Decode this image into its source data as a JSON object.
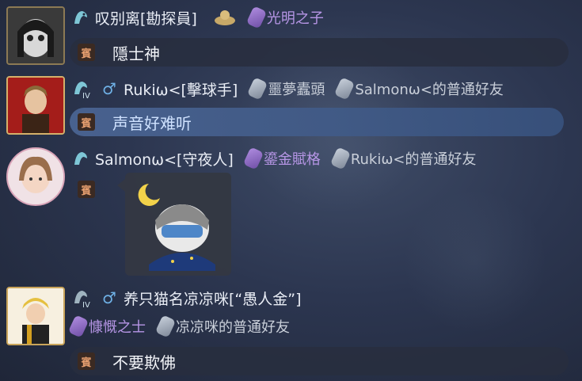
{
  "messages": [
    {
      "name": "叹别离[勘探員]",
      "tags": [
        {
          "label": "光明之子",
          "color": "purple"
        }
      ],
      "text": "隱士神"
    },
    {
      "name": "Rukiω<[擊球手]",
      "level_icon": "IV",
      "tags": [
        {
          "label": "噩夢蠹頭",
          "color": "grey"
        },
        {
          "label": "Salmonω<的普通好友",
          "color": "grey"
        }
      ],
      "text": "声音好难听"
    },
    {
      "name": "Salmonω<[守夜人]",
      "tags": [
        {
          "label": "鎏金賦格",
          "color": "purple"
        },
        {
          "label": "Rukiω<的普通好友",
          "color": "grey"
        }
      ],
      "sticker": "sleeping-character-sticker"
    },
    {
      "name": "养只猫名凉凉咪[“愚人金”]",
      "level_icon": "IV",
      "tags": [
        {
          "label": "慷慨之士",
          "color": "purple"
        },
        {
          "label": "凉凉咪的普通好友",
          "color": "grey"
        }
      ],
      "text": "不要欺佛"
    }
  ],
  "seal_char": "賓",
  "colors": {
    "purple_tag": "#b796e6",
    "grey_tag": "#c9cfd9",
    "highlight_bubble": "#4a6492"
  }
}
